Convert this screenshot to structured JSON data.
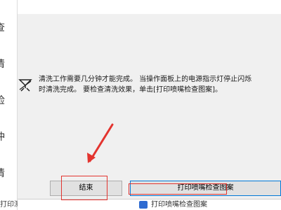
{
  "sidebar": {
    "chars": [
      "查",
      "清",
      "检",
      "冲",
      "清"
    ],
    "bottom_text": "打印测试页"
  },
  "dialog": {
    "message_lines": [
      "清洗工作需要几分钟才能完成。 当操作面板上的电源指示灯停止闪烁",
      "时清洗完成。 要检查清洗效果，单击[打印喷嘴检查图案]。"
    ],
    "icon": "nozzle-cleaning-icon",
    "buttons": {
      "finish": "结束",
      "print_nozzle_check": "打印喷嘴检查图案"
    }
  },
  "bottom_bar": {
    "text": "打印喷嘴检查图案"
  },
  "annotation": {
    "color": "#e3342f"
  }
}
